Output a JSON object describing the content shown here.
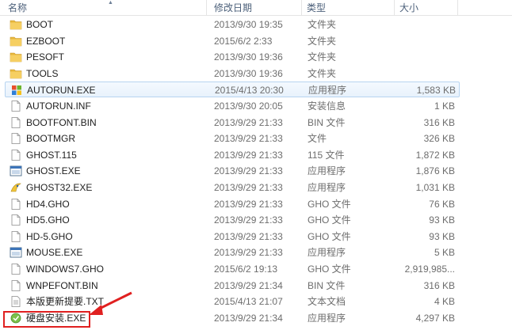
{
  "columns": {
    "name": "名称",
    "date": "修改日期",
    "type": "类型",
    "size": "大小"
  },
  "colors": {
    "folder": "#e8b83c",
    "highlight_box": "#e02020",
    "selected_row_border": "#b7d4f0"
  },
  "files": [
    {
      "name": "BOOT",
      "date": "2013/9/30 19:35",
      "type": "文件夹",
      "size": "",
      "icon": "folder-icon"
    },
    {
      "name": "EZBOOT",
      "date": "2015/6/2 2:33",
      "type": "文件夹",
      "size": "",
      "icon": "folder-icon"
    },
    {
      "name": "PESOFT",
      "date": "2013/9/30 19:36",
      "type": "文件夹",
      "size": "",
      "icon": "folder-icon"
    },
    {
      "name": "TOOLS",
      "date": "2013/9/30 19:36",
      "type": "文件夹",
      "size": "",
      "icon": "folder-icon"
    },
    {
      "name": "AUTORUN.EXE",
      "date": "2015/4/13 20:30",
      "type": "应用程序",
      "size": "1,583 KB",
      "icon": "windows-exe-icon"
    },
    {
      "name": "AUTORUN.INF",
      "date": "2013/9/30 20:05",
      "type": "安装信息",
      "size": "1 KB",
      "icon": "document-icon"
    },
    {
      "name": "BOOTFONT.BIN",
      "date": "2013/9/29 21:33",
      "type": "BIN 文件",
      "size": "316 KB",
      "icon": "document-icon"
    },
    {
      "name": "BOOTMGR",
      "date": "2013/9/29 21:33",
      "type": "文件",
      "size": "326 KB",
      "icon": "document-icon"
    },
    {
      "name": "GHOST.115",
      "date": "2013/9/29 21:33",
      "type": "115 文件",
      "size": "1,872 KB",
      "icon": "document-icon"
    },
    {
      "name": "GHOST.EXE",
      "date": "2013/9/29 21:33",
      "type": "应用程序",
      "size": "1,876 KB",
      "icon": "app-window-icon"
    },
    {
      "name": "GHOST32.EXE",
      "date": "2013/9/29 21:33",
      "type": "应用程序",
      "size": "1,031 KB",
      "icon": "ghost-icon"
    },
    {
      "name": "HD4.GHO",
      "date": "2013/9/29 21:33",
      "type": "GHO 文件",
      "size": "76 KB",
      "icon": "document-icon"
    },
    {
      "name": "HD5.GHO",
      "date": "2013/9/29 21:33",
      "type": "GHO 文件",
      "size": "93 KB",
      "icon": "document-icon"
    },
    {
      "name": "HD-5.GHO",
      "date": "2013/9/29 21:33",
      "type": "GHO 文件",
      "size": "93 KB",
      "icon": "document-icon"
    },
    {
      "name": "MOUSE.EXE",
      "date": "2013/9/29 21:33",
      "type": "应用程序",
      "size": "5 KB",
      "icon": "app-window-icon"
    },
    {
      "name": "WINDOWS7.GHO",
      "date": "2015/6/2 19:13",
      "type": "GHO 文件",
      "size": "2,919,985...",
      "icon": "document-icon"
    },
    {
      "name": "WNPEFONT.BIN",
      "date": "2013/9/29 21:34",
      "type": "BIN 文件",
      "size": "316 KB",
      "icon": "document-icon"
    },
    {
      "name": "本版更新提要.TXT",
      "date": "2015/4/13 21:07",
      "type": "文本文档",
      "size": "4 KB",
      "icon": "text-file-icon"
    },
    {
      "name": "硬盘安装.EXE",
      "date": "2013/9/29 21:34",
      "type": "应用程序",
      "size": "4,297 KB",
      "icon": "installer-icon"
    }
  ]
}
